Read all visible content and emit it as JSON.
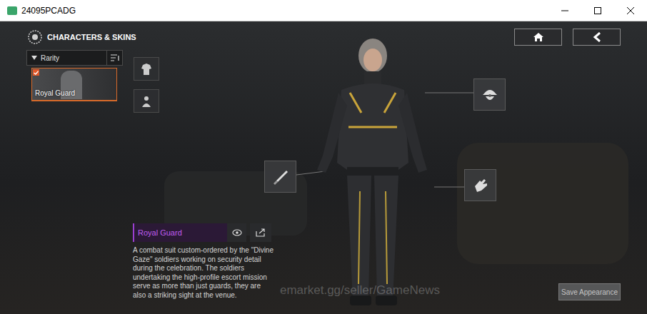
{
  "window": {
    "title": "24095PCADG"
  },
  "header": {
    "title": "CHARACTERS & SKINS"
  },
  "filter": {
    "label": "Rarity"
  },
  "skins": [
    {
      "name": "Royal Guard",
      "selected": true,
      "checked": true
    }
  ],
  "details": {
    "name": "Royal Guard",
    "description": "A combat suit custom-ordered by the \"Divine Gaze\" soldiers working on security detail during the celebration. The soldiers undertaking the high-profile escort mission serve as more than just guards, they are also a striking sight at the venue."
  },
  "watermark": "emarket.gg/seller/GameNews",
  "buttons": {
    "save": {
      "label": "Save Appearance",
      "disabled": true
    }
  }
}
